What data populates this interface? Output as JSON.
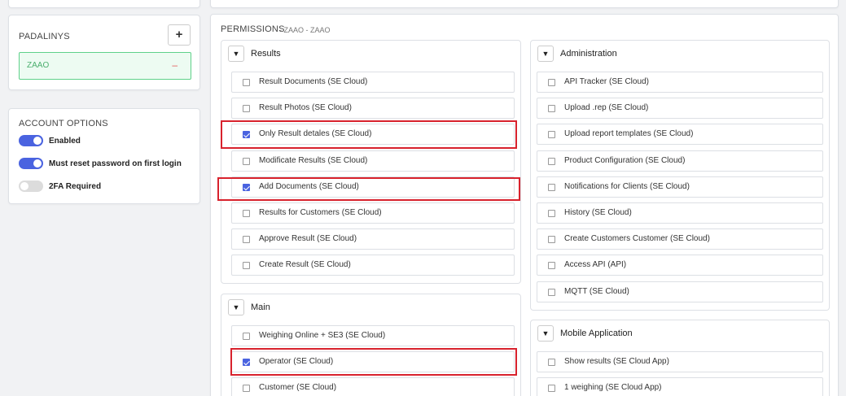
{
  "padalinys": {
    "title": "PADALINYS",
    "add_label": "+",
    "items": [
      {
        "label": "ZAAO",
        "remove_label": "–"
      }
    ]
  },
  "account_options": {
    "title": "ACCOUNT OPTIONS",
    "toggles": [
      {
        "label": "Enabled",
        "on": true
      },
      {
        "label": "Must reset password on first login",
        "on": true
      },
      {
        "label": "2FA Required",
        "on": false
      }
    ]
  },
  "permissions": {
    "title": "PERMISSIONS",
    "subtitle": "- ZAAO - ZAAO",
    "caret": "▼",
    "groups": {
      "results": {
        "title": "Results",
        "items": [
          {
            "label": "Result Documents (SE Cloud)",
            "checked": false
          },
          {
            "label": "Result Photos (SE Cloud)",
            "checked": false
          },
          {
            "label": "Only Result detales (SE Cloud)",
            "checked": true
          },
          {
            "label": "Modificate Results (SE Cloud)",
            "checked": false
          },
          {
            "label": "Add Documents (SE Cloud)",
            "checked": true
          },
          {
            "label": "Results for Customers (SE Cloud)",
            "checked": false
          },
          {
            "label": "Approve Result (SE Cloud)",
            "checked": false
          },
          {
            "label": "Create Result (SE Cloud)",
            "checked": false
          }
        ]
      },
      "main": {
        "title": "Main",
        "items": [
          {
            "label": "Weighing Online + SE3 (SE Cloud)",
            "checked": false
          },
          {
            "label": "Operator (SE Cloud)",
            "checked": true
          },
          {
            "label": "Customer (SE Cloud)",
            "checked": false
          }
        ]
      },
      "administration": {
        "title": "Administration",
        "items": [
          {
            "label": "API Tracker (SE Cloud)",
            "checked": false
          },
          {
            "label": "Upload .rep (SE Cloud)",
            "checked": false
          },
          {
            "label": "Upload report templates (SE Cloud)",
            "checked": false
          },
          {
            "label": "Product Configuration (SE Cloud)",
            "checked": false
          },
          {
            "label": "Notifications for Clients (SE Cloud)",
            "checked": false
          },
          {
            "label": "History (SE Cloud)",
            "checked": false
          },
          {
            "label": "Create Customers Customer (SE Cloud)",
            "checked": false
          },
          {
            "label": "Access API (API)",
            "checked": false
          },
          {
            "label": "MQTT (SE Cloud)",
            "checked": false
          }
        ]
      },
      "mobile": {
        "title": "Mobile Application",
        "items": [
          {
            "label": "Show results (SE Cloud App)",
            "checked": false
          },
          {
            "label": "1 weighing (SE Cloud App)",
            "checked": false
          }
        ]
      }
    }
  },
  "colors": {
    "accent": "#4a63e0",
    "highlight": "#d8222d",
    "success": "#4caf6e",
    "danger": "#e15a5a"
  }
}
